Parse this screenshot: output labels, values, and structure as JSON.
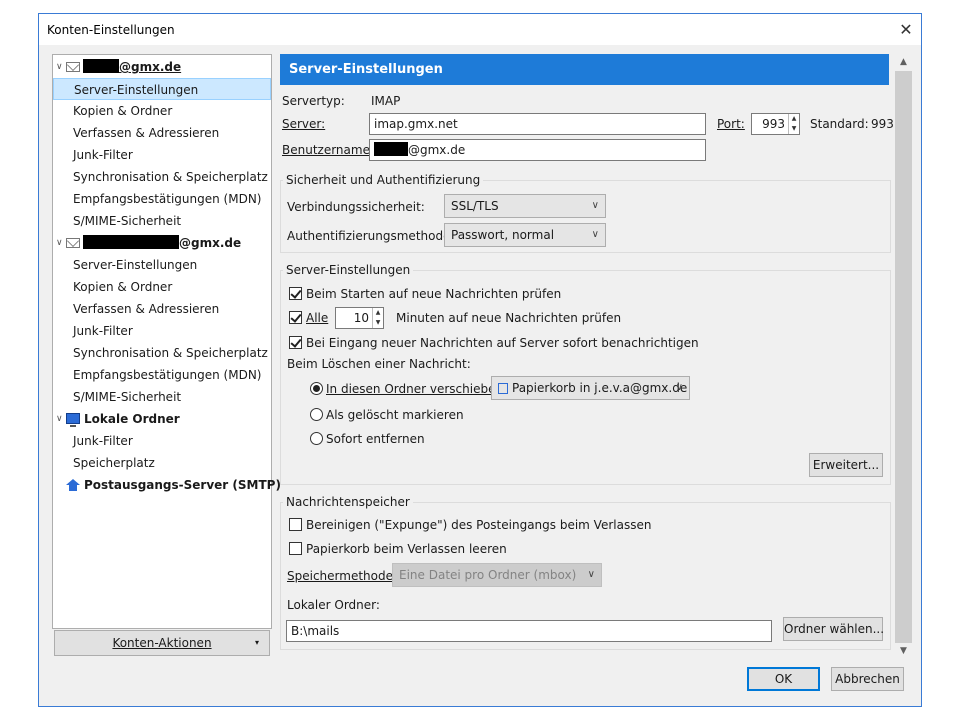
{
  "window": {
    "title": "Konten-Einstellungen",
    "close_glyph": "✕"
  },
  "tree": {
    "account1": {
      "email_suffix": "@gmx.de"
    },
    "account1_items": [
      "Server-Einstellungen",
      "Kopien & Ordner",
      "Verfassen & Adressieren",
      "Junk-Filter",
      "Synchronisation & Speicherplatz",
      "Empfangsbestätigungen (MDN)",
      "S/MIME-Sicherheit"
    ],
    "account2": {
      "email_suffix": "@gmx.de"
    },
    "account2_items": [
      "Server-Einstellungen",
      "Kopien & Ordner",
      "Verfassen & Adressieren",
      "Junk-Filter",
      "Synchronisation & Speicherplatz",
      "Empfangsbestätigungen (MDN)",
      "S/MIME-Sicherheit"
    ],
    "local": {
      "label": "Lokale Ordner",
      "items": [
        "Junk-Filter",
        "Speicherplatz"
      ]
    },
    "smtp": {
      "label": "Postausgangs-Server (SMTP)"
    }
  },
  "konten_aktionen": {
    "label": "Konten-Aktionen",
    "caret": "▾"
  },
  "panel": {
    "header": "Server-Einstellungen",
    "servertyp_label": "Servertyp:",
    "servertyp_value": "IMAP",
    "server_label": "Server:",
    "server_value": "imap.gmx.net",
    "port_label": "Port:",
    "port_value": "993",
    "standard_label": "Standard:",
    "standard_value": "993",
    "benutzer_label": "Benutzername:",
    "benutzer_suffix": "@gmx.de"
  },
  "security": {
    "title": "Sicherheit und Authentifizierung",
    "conn_label": "Verbindungssicherheit:",
    "conn_value": "SSL/TLS",
    "auth_label": "Authentifizierungsmethode:",
    "auth_value": "Passwort, normal"
  },
  "server_settings": {
    "title": "Server-Einstellungen",
    "check_on_start": {
      "label": "Beim Starten auf neue Nachrichten prüfen",
      "checked": true
    },
    "check_every": {
      "label": "Alle",
      "checked": true,
      "minutes": "10",
      "suffix": "Minuten auf neue Nachrichten prüfen"
    },
    "notify": {
      "label": "Bei Eingang neuer Nachrichten auf Server sofort benachrichtigen",
      "checked": true
    },
    "delete_label": "Beim Löschen einer Nachricht:",
    "move_to": {
      "label": "In diesen Ordner verschieben:",
      "selected": true,
      "folder": "Papierkorb in j.e.v.a@gmx.de"
    },
    "mark_deleted": {
      "label": "Als gelöscht markieren",
      "selected": false
    },
    "delete_now": {
      "label": "Sofort entfernen",
      "selected": false
    },
    "advanced_button": "Erweitert..."
  },
  "storage": {
    "title": "Nachrichtenspeicher",
    "expunge": {
      "label": "Bereinigen (\"Expunge\") des Posteingangs beim Verlassen",
      "checked": false
    },
    "empty_trash": {
      "label": "Papierkorb beim Verlassen leeren",
      "checked": false
    },
    "method_label": "Speichermethode:",
    "method_value": "Eine Datei pro Ordner (mbox)",
    "local_folder_label": "Lokaler Ordner:",
    "local_folder_value": "B:\\mails",
    "choose_folder_button": "Ordner wählen..."
  },
  "buttons": {
    "ok": "OK",
    "cancel": "Abbrechen"
  },
  "colors": {
    "accent": "#1e7bd8",
    "selection": "#cce8ff"
  }
}
